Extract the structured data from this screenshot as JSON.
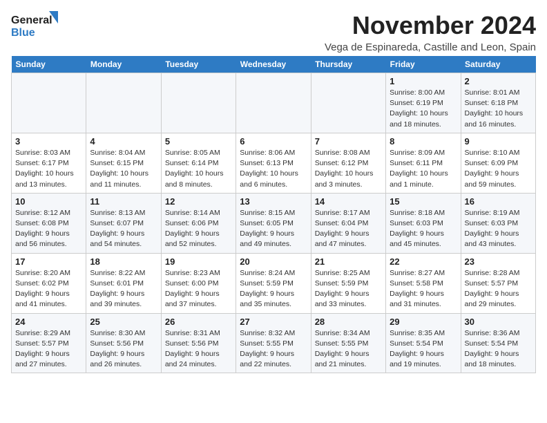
{
  "logo": {
    "line1": "General",
    "line2": "Blue"
  },
  "title": "November 2024",
  "subtitle": "Vega de Espinareda, Castille and Leon, Spain",
  "headers": [
    "Sunday",
    "Monday",
    "Tuesday",
    "Wednesday",
    "Thursday",
    "Friday",
    "Saturday"
  ],
  "weeks": [
    [
      {
        "day": "",
        "info": ""
      },
      {
        "day": "",
        "info": ""
      },
      {
        "day": "",
        "info": ""
      },
      {
        "day": "",
        "info": ""
      },
      {
        "day": "",
        "info": ""
      },
      {
        "day": "1",
        "info": "Sunrise: 8:00 AM\nSunset: 6:19 PM\nDaylight: 10 hours\nand 18 minutes."
      },
      {
        "day": "2",
        "info": "Sunrise: 8:01 AM\nSunset: 6:18 PM\nDaylight: 10 hours\nand 16 minutes."
      }
    ],
    [
      {
        "day": "3",
        "info": "Sunrise: 8:03 AM\nSunset: 6:17 PM\nDaylight: 10 hours\nand 13 minutes."
      },
      {
        "day": "4",
        "info": "Sunrise: 8:04 AM\nSunset: 6:15 PM\nDaylight: 10 hours\nand 11 minutes."
      },
      {
        "day": "5",
        "info": "Sunrise: 8:05 AM\nSunset: 6:14 PM\nDaylight: 10 hours\nand 8 minutes."
      },
      {
        "day": "6",
        "info": "Sunrise: 8:06 AM\nSunset: 6:13 PM\nDaylight: 10 hours\nand 6 minutes."
      },
      {
        "day": "7",
        "info": "Sunrise: 8:08 AM\nSunset: 6:12 PM\nDaylight: 10 hours\nand 3 minutes."
      },
      {
        "day": "8",
        "info": "Sunrise: 8:09 AM\nSunset: 6:11 PM\nDaylight: 10 hours\nand 1 minute."
      },
      {
        "day": "9",
        "info": "Sunrise: 8:10 AM\nSunset: 6:09 PM\nDaylight: 9 hours\nand 59 minutes."
      }
    ],
    [
      {
        "day": "10",
        "info": "Sunrise: 8:12 AM\nSunset: 6:08 PM\nDaylight: 9 hours\nand 56 minutes."
      },
      {
        "day": "11",
        "info": "Sunrise: 8:13 AM\nSunset: 6:07 PM\nDaylight: 9 hours\nand 54 minutes."
      },
      {
        "day": "12",
        "info": "Sunrise: 8:14 AM\nSunset: 6:06 PM\nDaylight: 9 hours\nand 52 minutes."
      },
      {
        "day": "13",
        "info": "Sunrise: 8:15 AM\nSunset: 6:05 PM\nDaylight: 9 hours\nand 49 minutes."
      },
      {
        "day": "14",
        "info": "Sunrise: 8:17 AM\nSunset: 6:04 PM\nDaylight: 9 hours\nand 47 minutes."
      },
      {
        "day": "15",
        "info": "Sunrise: 8:18 AM\nSunset: 6:03 PM\nDaylight: 9 hours\nand 45 minutes."
      },
      {
        "day": "16",
        "info": "Sunrise: 8:19 AM\nSunset: 6:03 PM\nDaylight: 9 hours\nand 43 minutes."
      }
    ],
    [
      {
        "day": "17",
        "info": "Sunrise: 8:20 AM\nSunset: 6:02 PM\nDaylight: 9 hours\nand 41 minutes."
      },
      {
        "day": "18",
        "info": "Sunrise: 8:22 AM\nSunset: 6:01 PM\nDaylight: 9 hours\nand 39 minutes."
      },
      {
        "day": "19",
        "info": "Sunrise: 8:23 AM\nSunset: 6:00 PM\nDaylight: 9 hours\nand 37 minutes."
      },
      {
        "day": "20",
        "info": "Sunrise: 8:24 AM\nSunset: 5:59 PM\nDaylight: 9 hours\nand 35 minutes."
      },
      {
        "day": "21",
        "info": "Sunrise: 8:25 AM\nSunset: 5:59 PM\nDaylight: 9 hours\nand 33 minutes."
      },
      {
        "day": "22",
        "info": "Sunrise: 8:27 AM\nSunset: 5:58 PM\nDaylight: 9 hours\nand 31 minutes."
      },
      {
        "day": "23",
        "info": "Sunrise: 8:28 AM\nSunset: 5:57 PM\nDaylight: 9 hours\nand 29 minutes."
      }
    ],
    [
      {
        "day": "24",
        "info": "Sunrise: 8:29 AM\nSunset: 5:57 PM\nDaylight: 9 hours\nand 27 minutes."
      },
      {
        "day": "25",
        "info": "Sunrise: 8:30 AM\nSunset: 5:56 PM\nDaylight: 9 hours\nand 26 minutes."
      },
      {
        "day": "26",
        "info": "Sunrise: 8:31 AM\nSunset: 5:56 PM\nDaylight: 9 hours\nand 24 minutes."
      },
      {
        "day": "27",
        "info": "Sunrise: 8:32 AM\nSunset: 5:55 PM\nDaylight: 9 hours\nand 22 minutes."
      },
      {
        "day": "28",
        "info": "Sunrise: 8:34 AM\nSunset: 5:55 PM\nDaylight: 9 hours\nand 21 minutes."
      },
      {
        "day": "29",
        "info": "Sunrise: 8:35 AM\nSunset: 5:54 PM\nDaylight: 9 hours\nand 19 minutes."
      },
      {
        "day": "30",
        "info": "Sunrise: 8:36 AM\nSunset: 5:54 PM\nDaylight: 9 hours\nand 18 minutes."
      }
    ]
  ]
}
